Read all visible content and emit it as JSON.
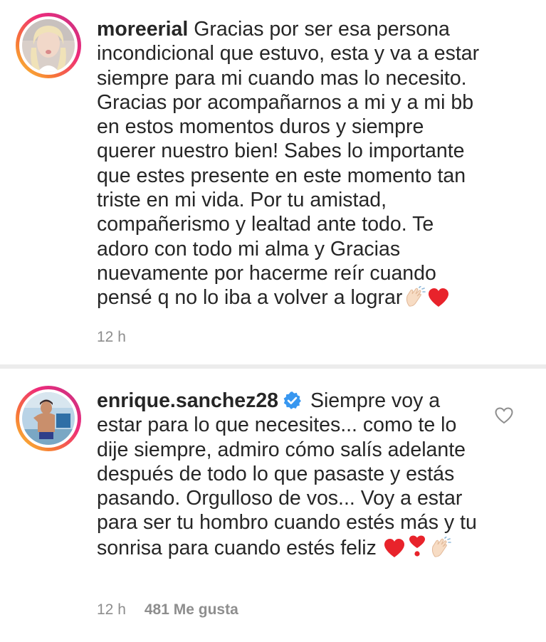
{
  "comments": [
    {
      "username": "moreerial",
      "verified": false,
      "text": "Gracias por ser esa persona incondicional que estuvo, esta y va a estar siempre para mi cuando mas lo necesito. Gracias por acompañarnos a mi y a mi bb en estos momentos duros y siempre querer nuestro bien! Sabes lo importante que estes presente en este momento tan triste en mi vida. Por tu amistad, compañerismo y lealtad ante todo. Te adoro con todo mi alma y Gracias nuevamente por hacerme reír cuando pensé q no lo iba a volver a lograr",
      "emojis": [
        "clapping-hands",
        "red-heart"
      ],
      "time": "12 h",
      "likes": ""
    },
    {
      "username": "enrique.sanchez28",
      "verified": true,
      "text": "Siempre voy a estar para lo que necesites... como te lo dije siempre, admiro cómo salís adelante después de todo lo que pasaste y estás pasando. Orgulloso de vos... Voy a estar para ser tu hombro cuando estés más y tu sonrisa para cuando estés feliz",
      "emojis": [
        "red-heart",
        "heart-exclamation",
        "clapping-hands"
      ],
      "time": "12 h",
      "likes": "481 Me gusta"
    }
  ],
  "colors": {
    "text": "#262626",
    "meta": "#8e8e8e",
    "verified_blue": "#3897f0",
    "heart_red": "#e8232b",
    "divider": "#ececec"
  },
  "icons": {
    "like": "heart-outline-icon",
    "verified": "verified-badge-icon"
  }
}
